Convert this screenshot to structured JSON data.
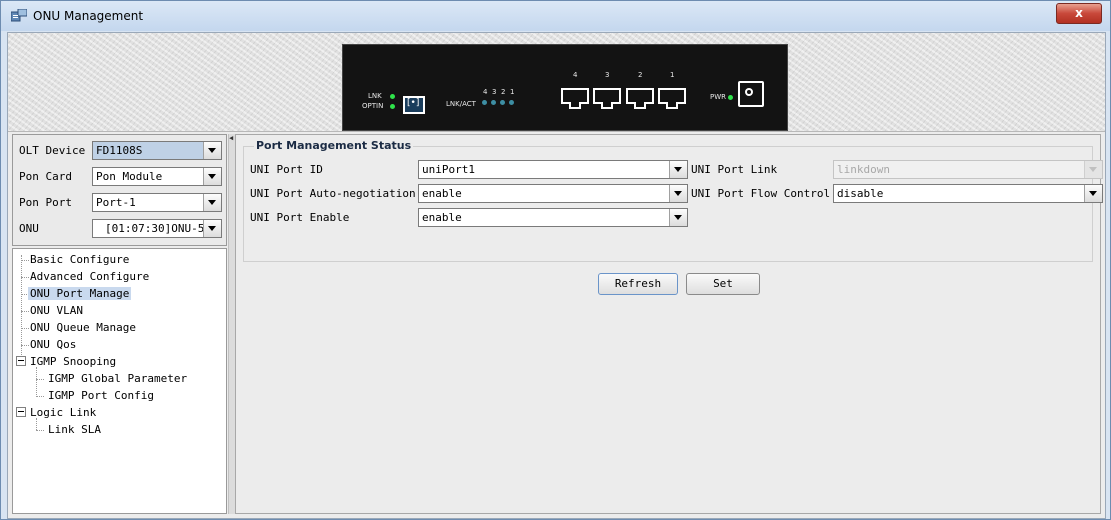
{
  "window": {
    "title": "ONU Management",
    "close_label": "x"
  },
  "device": {
    "lnk": "LNK",
    "optin": "OPTIN",
    "lnkact": "LNK/ACT",
    "led_numbers": [
      "4",
      "3",
      "2",
      "1"
    ],
    "port_numbers": [
      "4",
      "3",
      "2",
      "1"
    ],
    "pwr": "PWR",
    "opt_glyph": "[•]"
  },
  "selectors": {
    "olt_device": {
      "label": "OLT Device",
      "value": "FD1108S"
    },
    "pon_card": {
      "label": "Pon Card",
      "value": "Pon Module"
    },
    "pon_port": {
      "label": "Pon Port",
      "value": "Port-1"
    },
    "onu": {
      "label": "ONU",
      "value": "[01:07:30]ONU-5"
    }
  },
  "tree": {
    "items": [
      {
        "label": "Basic Configure"
      },
      {
        "label": "Advanced Configure"
      },
      {
        "label": "ONU Port Manage",
        "selected": true
      },
      {
        "label": "ONU VLAN"
      },
      {
        "label": "ONU Queue Manage"
      },
      {
        "label": "ONU Qos"
      },
      {
        "label": "IGMP Snooping",
        "expanded": true,
        "children": [
          "IGMP Global Parameter",
          "IGMP Port Config"
        ]
      },
      {
        "label": "Logic Link",
        "expanded": true,
        "children": [
          "Link SLA"
        ]
      }
    ]
  },
  "port_status": {
    "title": "Port Management Status",
    "uni_port_id": {
      "label": "UNI Port ID",
      "value": "uniPort1"
    },
    "uni_port_link": {
      "label": "UNI Port Link",
      "value": "linkdown"
    },
    "auto_neg": {
      "label": "UNI Port Auto-negotiation",
      "value": "enable"
    },
    "flow_control": {
      "label": "UNI Port Flow Control",
      "value": "disable"
    },
    "port_enable": {
      "label": "UNI Port Enable",
      "value": "enable"
    }
  },
  "buttons": {
    "refresh": "Refresh",
    "set": "Set"
  },
  "colors": {
    "led_green": "#2fe24b",
    "led_blue": "#3d8ea3",
    "selection": "#c9d9ee"
  }
}
